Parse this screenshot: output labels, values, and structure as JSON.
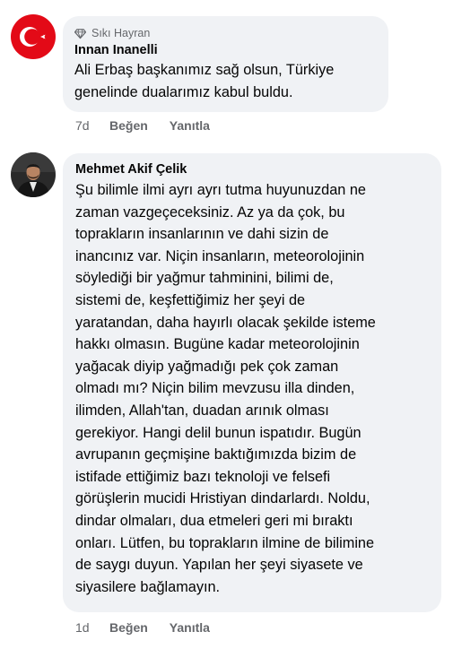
{
  "comments": [
    {
      "badge": "Sıkı Hayran",
      "badge_icon": "diamond-icon",
      "author": "Innan Inanelli",
      "text": "Ali Erbaş başkanımız sağ olsun, Türkiye\ngenelinde dualarımız kabul buldu.",
      "time": "7d",
      "like_label": "Beğen",
      "reply_label": "Yanıtla",
      "avatar": "turkish-flag-avatar"
    },
    {
      "author": "Mehmet Akif Çelik",
      "text": "Şu bilimle ilmi ayrı ayrı tutma huyunuzdan ne\nzaman vazgeçeceksiniz. Az ya da çok, bu\ntoprakların insanlarının ve dahi sizin de\ninancınız var. Niçin insanların, meteorolojinin\nsöylediği bir yağmur tahminini, bilimi de,\nsistemi de, keşfettiğimiz her şeyi de\nyaratandan, daha hayırlı olacak şekilde isteme\nhakkı olmasın. Bugüne kadar meteorolojinin\nyağacak diyip yağmadığı pek çok zaman\nolmadı mı? Niçin bilim mevzusu illa dinden,\nilimden, Allah'tan, duadan arınık olması\ngerekiyor. Hangi delil bunun ispatıdır. Bugün\navrupanın geçmişine baktığımızda bizim de\nistifade ettiğimiz bazı teknoloji ve felsefi\ngörüşlerin mucidi Hristiyan dindarlardı. Noldu,\ndindar olmaları, dua etmeleri geri mi bıraktı\nonları. Lütfen, bu toprakların ilmine de bilimine\nde saygı duyun. Yapılan her şeyi siyasete ve\nsiyasilere bağlamayın.",
      "time": "1d",
      "like_label": "Beğen",
      "reply_label": "Yanıtla",
      "avatar": "user-photo-avatar"
    }
  ],
  "colors": {
    "bubble": "#f0f2f5",
    "text": "#050505",
    "secondary": "#65676b",
    "flag_red": "#e30a17"
  }
}
